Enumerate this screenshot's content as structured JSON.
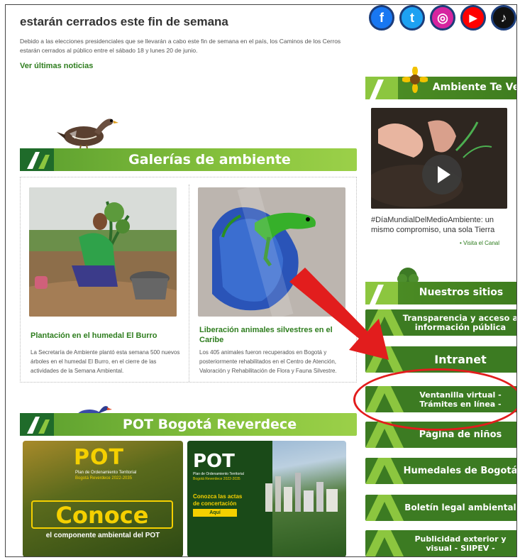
{
  "news": {
    "title": "estarán cerrados este fin de semana",
    "body": "Debido a las elecciones presidenciales que se llevarán a cabo este fin de semana en el país, los Caminos de los Cerros estarán cerrados al público entre el sábado 18 y lunes 20 de junio.",
    "link": "Ver últimas noticias"
  },
  "galleries": {
    "title": "Galerías de ambiente",
    "cards": [
      {
        "title": "Plantación en el humedal El Burro",
        "text": "La Secretaría de Ambiente plantó esta semana 500 nuevos árboles en el humedal El Burro, en el cierre de las actividades de la Semana Ambiental."
      },
      {
        "title": "Liberación animales silvestres en el Caribe",
        "text": "Los 405 animales fueron recuperados en Bogotá y posteriormente rehabilitados en el Centro de Atención, Valoración y Rehabilitación de Flora y Fauna Silvestre."
      }
    ]
  },
  "pot": {
    "title": "POT Bogotá Reverdece",
    "card1": {
      "logo": "POT",
      "sub": "Plan de Ordenamiento Territorial",
      "brand": "Bogotá Reverdece 2022-2035",
      "big": "Conoce",
      "small": "el componente ambiental del POT"
    },
    "card2": {
      "logo": "POT",
      "sub": "Plan de Ordenamiento Territorial",
      "brand": "Bogotá Reverdece 2022-2035",
      "line1": "Conozca las actas",
      "line2": "de concertación",
      "btn": "Aquí"
    }
  },
  "social": [
    {
      "icon": "facebook-icon",
      "glyph": "f",
      "color": "#1877f2"
    },
    {
      "icon": "twitter-icon",
      "glyph": "t",
      "color": "#1da1f2"
    },
    {
      "icon": "instagram-icon",
      "glyph": "◎",
      "color": "#d6249f"
    },
    {
      "icon": "youtube-icon",
      "glyph": "▶",
      "color": "#ff0000"
    },
    {
      "icon": "tiktok-icon",
      "glyph": "♪",
      "color": "#111111"
    }
  ],
  "ambiente_te_ve": {
    "title": "Ambiente Te Ve",
    "video_caption": "#DíaMundialDelMedioAmbiente: un mismo compromiso, una sola Tierra",
    "visita": "Visita el Canal"
  },
  "sites": {
    "title": "Nuestros sitios",
    "items": [
      {
        "label": "Transparencia y acceso a información pública"
      },
      {
        "label": "Intranet"
      },
      {
        "label": "Ventanilla virtual - Trámites en línea -"
      },
      {
        "label": "Página de niños"
      },
      {
        "label": "Humedales de Bogotá"
      },
      {
        "label": "Boletín legal ambiental"
      },
      {
        "label": "Publicidad exterior y visual - SIIPEV -"
      }
    ]
  },
  "colors": {
    "brand_green": "#3c7b22",
    "light_green": "#8cc63f",
    "annotation_red": "#e21d1d"
  }
}
